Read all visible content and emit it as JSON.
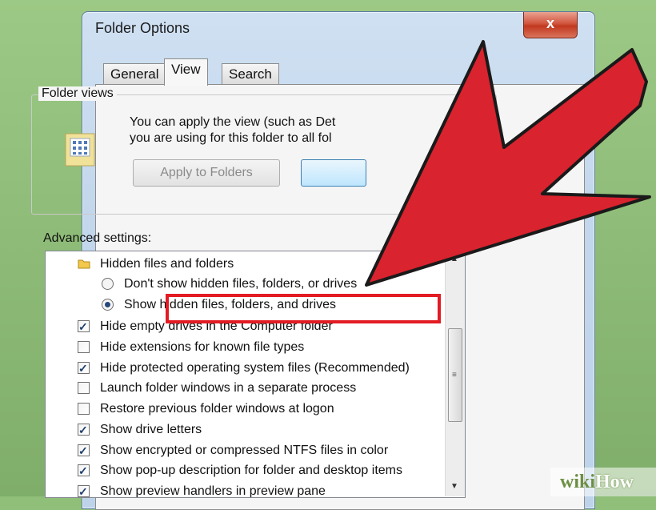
{
  "window": {
    "title": "Folder Options",
    "close_label": "x"
  },
  "tabs": [
    {
      "label": "General",
      "active": false
    },
    {
      "label": "View",
      "active": true
    },
    {
      "label": "Search",
      "active": false
    }
  ],
  "folder_views": {
    "legend": "Folder views",
    "text_line1": "You can apply the view (such as Det",
    "text_line2": "you are using for this folder to all fol",
    "apply_button": "Apply to Folders"
  },
  "advanced": {
    "label": "Advanced settings:",
    "items": [
      {
        "type": "folder",
        "label": "Hidden files and folders"
      },
      {
        "type": "radio",
        "checked": false,
        "label": "Don't show hidden files, folders, or drives"
      },
      {
        "type": "radio",
        "checked": true,
        "label": "Show hidden files, folders, and drives"
      },
      {
        "type": "checkbox",
        "checked": true,
        "label": "Hide empty drives in the Computer folder"
      },
      {
        "type": "checkbox",
        "checked": false,
        "label": "Hide extensions for known file types"
      },
      {
        "type": "checkbox",
        "checked": true,
        "label": "Hide protected operating system files (Recommended)"
      },
      {
        "type": "checkbox",
        "checked": false,
        "label": "Launch folder windows in a separate process"
      },
      {
        "type": "checkbox",
        "checked": false,
        "label": "Restore previous folder windows at logon"
      },
      {
        "type": "checkbox",
        "checked": true,
        "label": "Show drive letters"
      },
      {
        "type": "checkbox",
        "checked": true,
        "label": "Show encrypted or compressed NTFS files in color"
      },
      {
        "type": "checkbox",
        "checked": true,
        "label": "Show pop-up description for folder and desktop items"
      },
      {
        "type": "checkbox",
        "checked": true,
        "label": "Show preview handlers in preview pane"
      }
    ]
  },
  "watermark": {
    "wiki": "wiki",
    "how": "How"
  },
  "colors": {
    "highlight": "#e31b23",
    "arrow": "#d9232e"
  }
}
